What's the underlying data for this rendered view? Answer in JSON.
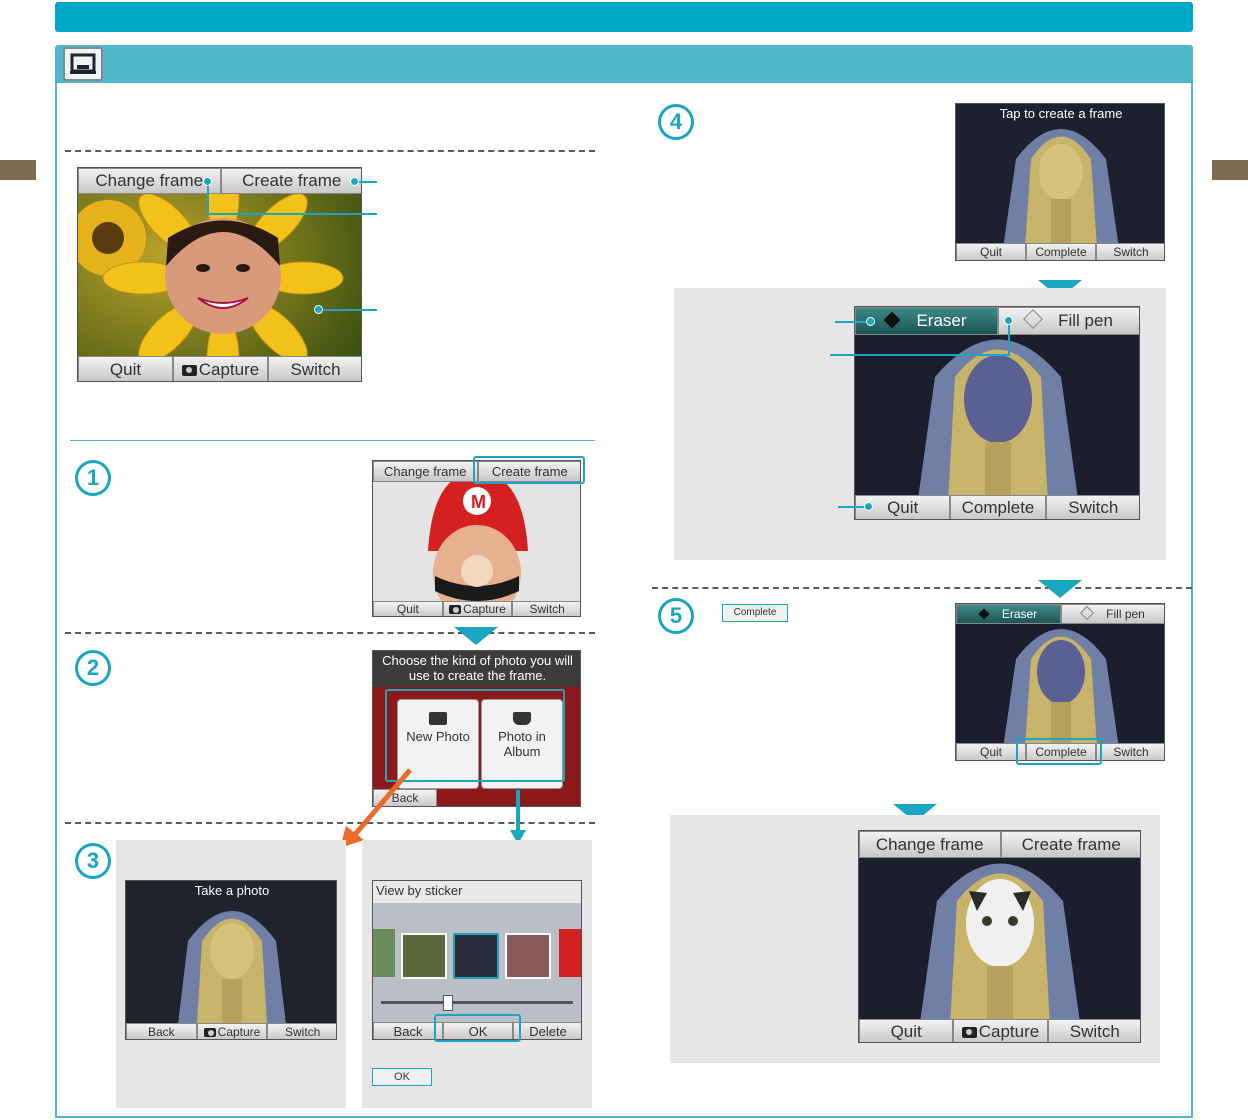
{
  "colors": {
    "accent": "#00a9c6",
    "section": "#4fb8cb",
    "side_tab": "#7c6a52"
  },
  "section_icon": "photo-frame-icon",
  "step_numbers": [
    "1",
    "2",
    "3",
    "4",
    "5"
  ],
  "hero": {
    "tab_change": "Change frame",
    "tab_create": "Create frame",
    "btn_quit": "Quit",
    "btn_capture": "Capture",
    "btn_switch": "Switch"
  },
  "step1": {
    "tab_change": "Change frame",
    "tab_create": "Create frame",
    "btn_quit": "Quit",
    "btn_capture": "Capture",
    "btn_switch": "Switch"
  },
  "step2": {
    "prompt": "Choose the kind of photo you will use to create the frame.",
    "new_photo": "New Photo",
    "album": "Photo in Album",
    "back": "Back"
  },
  "step3a": {
    "caption": "Take a photo",
    "back": "Back",
    "capture": "Capture",
    "switch": "Switch"
  },
  "step3b": {
    "caption": "View by sticker",
    "back": "Back",
    "ok": "OK",
    "delete": "Delete",
    "ok_icon_label": "OK"
  },
  "step4_top": {
    "caption": "Tap to create a frame",
    "quit": "Quit",
    "complete": "Complete",
    "switch": "Switch"
  },
  "step4_big": {
    "eraser": "Eraser",
    "fillpen": "Fill pen",
    "quit": "Quit",
    "complete": "Complete",
    "switch": "Switch"
  },
  "step5": {
    "inline_button": "Complete",
    "eraser": "Eraser",
    "fillpen": "Fill pen",
    "quit": "Quit",
    "complete": "Complete",
    "switch": "Switch"
  },
  "result": {
    "tab_change": "Change frame",
    "tab_create": "Create frame",
    "quit": "Quit",
    "capture": "Capture",
    "switch": "Switch"
  }
}
